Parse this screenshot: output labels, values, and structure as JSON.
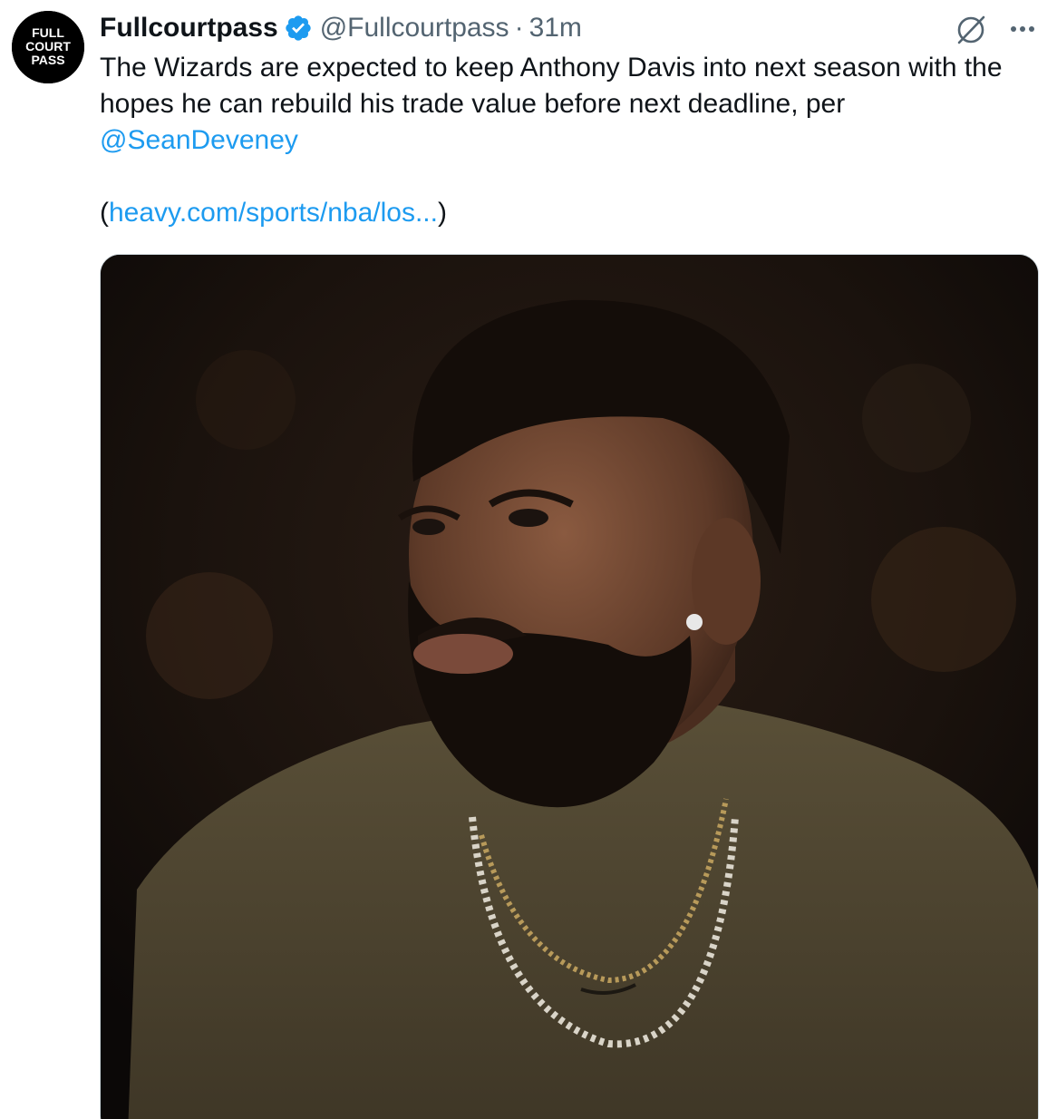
{
  "avatar": {
    "line1": "FULL",
    "line2": "COURT",
    "line3": "PASS"
  },
  "author": {
    "display_name": "Fullcourtpass",
    "handle": "@Fullcourtpass",
    "separator": "·",
    "time": "31m",
    "verified": true
  },
  "tweet": {
    "text": "The Wizards are expected to keep Anthony Davis into next season with the hopes he can rebuild his trade value before next deadline, per",
    "mention": "@SeanDeveney",
    "link_open": "(",
    "link": "heavy.com/sports/nba/los...",
    "link_close": ")"
  },
  "icons": {
    "grok": "grok-icon",
    "more": "more-icon",
    "verified": "verified-badge-icon"
  },
  "colors": {
    "accent": "#1d9bf0",
    "text": "#0f1419",
    "muted": "#536471"
  }
}
